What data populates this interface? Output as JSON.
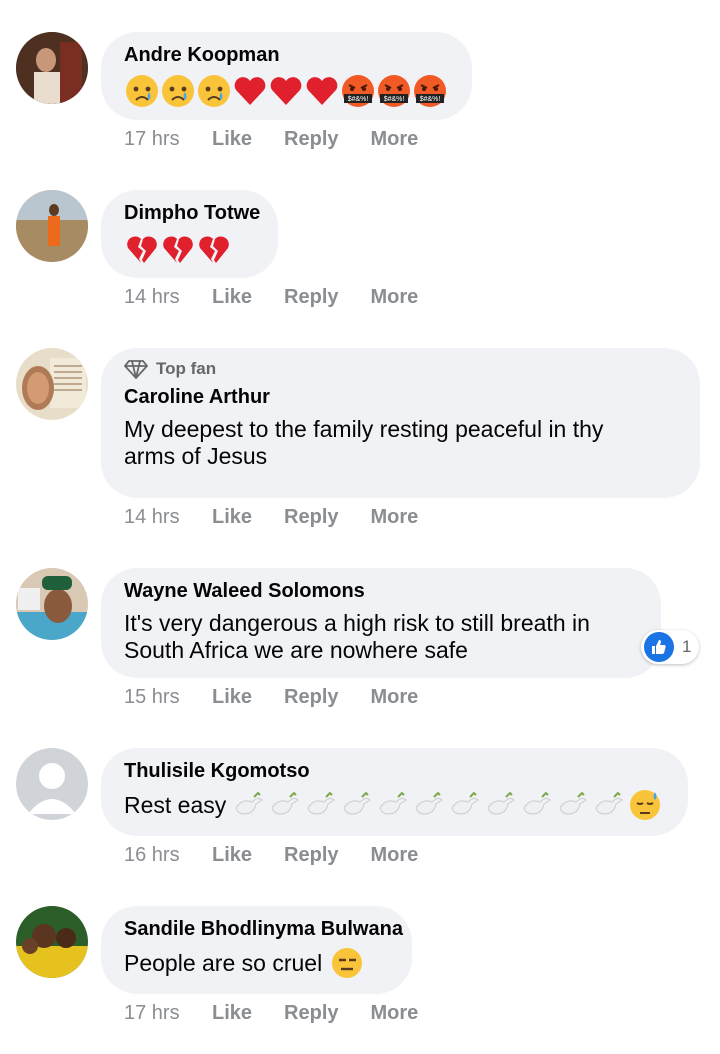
{
  "comments": [
    {
      "name": "Andre Koopman",
      "time": "17 hrs",
      "like": "Like",
      "reply": "Reply",
      "more": "More",
      "emojis": [
        "crying-face",
        "crying-face",
        "crying-face",
        "red-heart",
        "red-heart",
        "red-heart",
        "swearing-face",
        "swearing-face",
        "swearing-face"
      ],
      "swear_text": "$#&%!"
    },
    {
      "name": "Dimpho Totwe",
      "time": "14 hrs",
      "like": "Like",
      "reply": "Reply",
      "more": "More",
      "emojis": [
        "broken-heart",
        "broken-heart",
        "broken-heart"
      ]
    },
    {
      "badge": "Top fan",
      "name": "Caroline Arthur",
      "text": "My deepest to the family resting peaceful in thy arms of Jesus",
      "time": "14 hrs",
      "like": "Like",
      "reply": "Reply",
      "more": "More"
    },
    {
      "name": "Wayne Waleed Solomons",
      "text": "It's very dangerous a high risk to still breath in South Africa we are nowhere safe",
      "time": "15 hrs",
      "like": "Like",
      "reply": "Reply",
      "more": "More",
      "like_count": "1"
    },
    {
      "name": "Thulisile Kgomotso",
      "text": "Rest easy",
      "emojis": [
        "dove",
        "dove",
        "dove",
        "dove",
        "dove",
        "dove",
        "dove",
        "dove",
        "dove",
        "dove",
        "dove",
        "downcast-sweat-face"
      ],
      "time": "16 hrs",
      "like": "Like",
      "reply": "Reply",
      "more": "More"
    },
    {
      "name": "Sandile Bhodlinyma Bulwana",
      "text": "People are so cruel",
      "emojis": [
        "expressionless-face"
      ],
      "time": "17 hrs",
      "like": "Like",
      "reply": "Reply",
      "more": "More"
    }
  ],
  "colors": {
    "bubble": "#f0f2f5",
    "meta": "#8a8d91",
    "like_blue": "#1b74e4"
  }
}
